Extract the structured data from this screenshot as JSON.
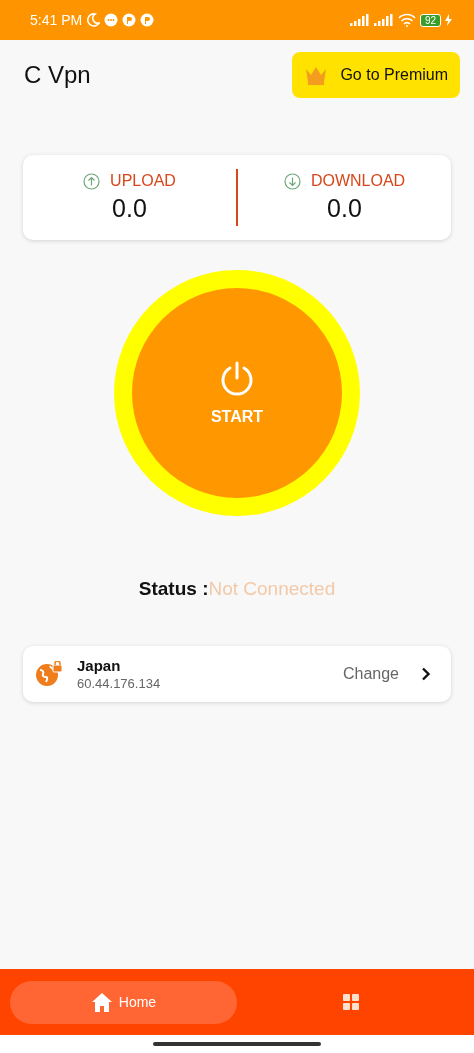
{
  "status_bar": {
    "time": "5:41 PM",
    "battery": "92"
  },
  "app_title": "C Vpn",
  "premium_button": {
    "label": "Go to Premium"
  },
  "stats": [
    {
      "kind": "upload",
      "label": "UPLOAD",
      "value": "0.0"
    },
    {
      "kind": "download",
      "label": "DOWNLOAD",
      "value": "0.0"
    }
  ],
  "power_button": {
    "label": "START"
  },
  "status": {
    "label": "Status :",
    "value": "Not Connected"
  },
  "server": {
    "name": "Japan",
    "ip": "60.44.176.134",
    "action": "Change"
  },
  "nav": [
    {
      "kind": "home",
      "label": "Home",
      "selected": true
    },
    {
      "kind": "grid",
      "selected": false
    }
  ]
}
